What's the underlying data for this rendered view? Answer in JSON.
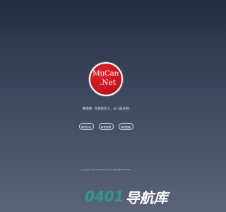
{
  "logo": {
    "line1": "MuCan",
    "line2": ".Net"
  },
  "tagline": "慕悦网 - 无花悦佳人，从门前开始!",
  "buttons": [
    {
      "label": "慕悦论坛"
    },
    {
      "label": "慕悦视频"
    },
    {
      "label": "慕悦图板"
    }
  ],
  "footer": "Copyright © 2024 All Rights Reserved | 豫ICP备2023000739",
  "watermark": {
    "digits": "0401",
    "text": "导航库"
  },
  "colors": {
    "background_top": "#252d40",
    "background_bottom": "#5a6378",
    "logo_red": "#c2131b",
    "watermark_accent": "#2a9d8f"
  }
}
